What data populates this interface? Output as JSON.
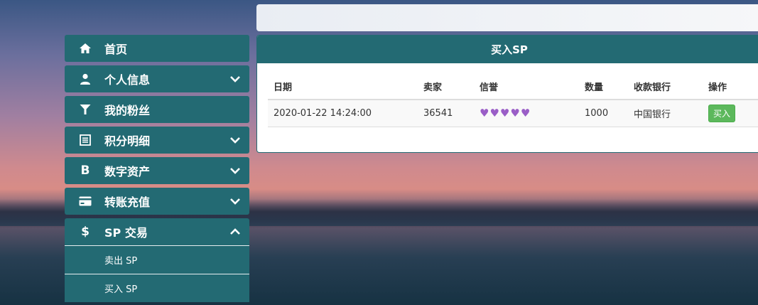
{
  "sidebar": {
    "items": [
      {
        "label": "首页",
        "icon": "home-icon",
        "expandable": false
      },
      {
        "label": "个人信息",
        "icon": "user-icon",
        "expandable": true
      },
      {
        "label": "我的粉丝",
        "icon": "filter-icon",
        "expandable": false
      },
      {
        "label": "积分明细",
        "icon": "list-icon",
        "expandable": true
      },
      {
        "label": "数字资产",
        "icon": "bitcoin-icon",
        "expandable": true
      },
      {
        "label": "转账充值",
        "icon": "card-icon",
        "expandable": true
      },
      {
        "label": "SP 交易",
        "icon": "dollar-icon",
        "expandable": true,
        "open": true
      }
    ],
    "subitems": [
      {
        "label": "卖出 SP"
      },
      {
        "label": "买入 SP"
      }
    ]
  },
  "panel": {
    "title": "买入SP",
    "columns": [
      "日期",
      "卖家",
      "信誉",
      "数量",
      "收款银行",
      "操作"
    ],
    "rows": [
      {
        "date": "2020-01-22 14:24:00",
        "seller": "36541",
        "rating": 5,
        "quantity": "1000",
        "bank": "中国银行",
        "action": "买入"
      }
    ]
  },
  "colors": {
    "teal": "#236a73",
    "heart": "#9a5ec7",
    "buy": "#5cb85c"
  }
}
